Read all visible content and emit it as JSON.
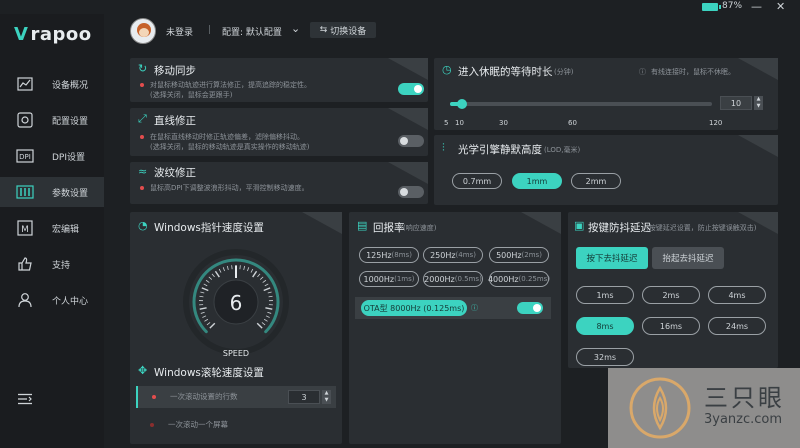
{
  "window": {
    "battery_pct": "87%",
    "minimize_icon": "minimize-icon",
    "close_icon": "close-icon"
  },
  "brand": {
    "logo_text": "rapoo"
  },
  "sidebar": {
    "items": [
      {
        "label": "设备概况",
        "icon": "chart-icon"
      },
      {
        "label": "配置设置",
        "icon": "config-icon"
      },
      {
        "label": "DPI设置",
        "icon": "dpi-icon"
      },
      {
        "label": "参数设置",
        "icon": "params-icon",
        "active": true
      },
      {
        "label": "宏编辑",
        "icon": "macro-icon"
      },
      {
        "label": "支持",
        "icon": "thumbs-up-icon"
      },
      {
        "label": "个人中心",
        "icon": "user-icon"
      }
    ],
    "collapse_icon": "collapse-icon"
  },
  "header": {
    "user_status": "未登录",
    "separator": "|",
    "profile_label": "配置: 默认配置",
    "switch_device": "切换设备"
  },
  "motion_sync": {
    "title": "移动同步",
    "desc_line1": "对鼠标移动轨迹进行算法修正，提高追踪的稳定性。",
    "desc_line2": "(选择关闭，鼠标会更跟手)",
    "enabled": true
  },
  "angle_snap": {
    "title": "直线修正",
    "desc_line1": "在鼠标直线移动时修正轨迹偏差，滤除偏移抖动。",
    "desc_line2": "(选择关闭，鼠标的移动轨迹是真实操作的移动轨迹)",
    "enabled": false
  },
  "ripple": {
    "title": "波纹修正",
    "desc_line1": "鼠标高DPI下调整波浪形抖动，平滑控制移动速度。",
    "enabled": false
  },
  "sleep": {
    "title": "进入休眠的等待时长",
    "unit": "(分钟)",
    "note": "有线连接时，鼠标不休眠。",
    "value": "10",
    "ticks": [
      "5",
      "10",
      "30",
      "60",
      "120"
    ],
    "fraction": 0.03
  },
  "lod": {
    "title": "光学引擎静默高度",
    "unit": "(LOD,毫米)",
    "options": [
      "0.7mm",
      "1mm",
      "2mm"
    ],
    "selected": "1mm"
  },
  "windows_speed": {
    "title": "Windows指针速度设置",
    "value": "6",
    "gauge_label": "SPEED",
    "fraction": 0.5
  },
  "scroll": {
    "title": "Windows滚轮速度设置",
    "row1_label": "一次滚动设置的行数",
    "row1_value": "3",
    "row2_label": "一次滚动一个屏幕"
  },
  "polling": {
    "title": "回报率",
    "unit": "(响应速度)",
    "options": [
      {
        "main": "125Hz",
        "sub": "(8ms)"
      },
      {
        "main": "250Hz",
        "sub": "(4ms)"
      },
      {
        "main": "500Hz",
        "sub": "(2ms)"
      },
      {
        "main": "1000Hz",
        "sub": "(1ms)"
      },
      {
        "main": "2000Hz",
        "sub": "(0.5ms)"
      },
      {
        "main": "4000Hz",
        "sub": "(0.25ms)"
      }
    ],
    "ota_label": "OTA型 8000Hz (0.125ms)",
    "ota_enabled": true
  },
  "debounce": {
    "title": "按键防抖延迟",
    "unit": "(按键延迟设置，防止按键误触双击)",
    "tab_press": "按下去抖延迟",
    "tab_release": "抬起去抖延迟",
    "options": [
      "1ms",
      "2ms",
      "4ms",
      "8ms",
      "16ms",
      "24ms",
      "32ms"
    ],
    "selected": "8ms"
  },
  "watermark": {
    "cn": "三只眼",
    "url": "3yanzc.com"
  }
}
